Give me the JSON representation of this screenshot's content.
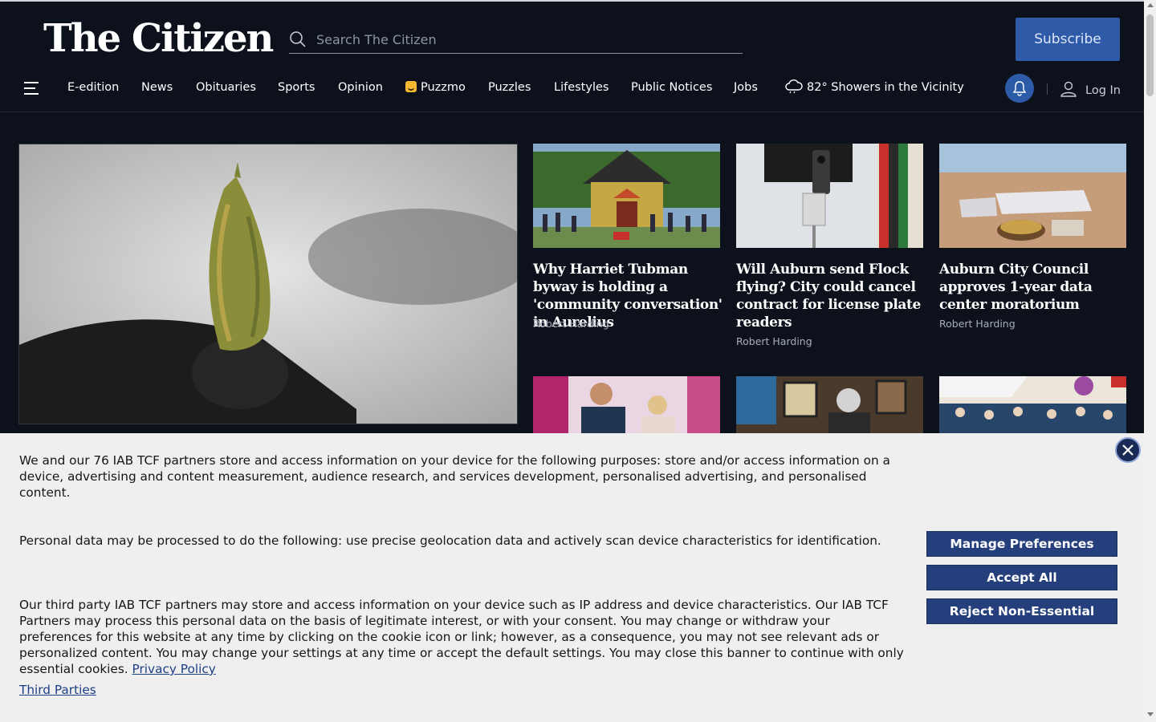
{
  "colors": {
    "page_bg": "#0c111c",
    "accent": "#2f5aa8",
    "cookie_bg": "#efefef",
    "cookie_button": "#253f7c",
    "link": "#1d3f86"
  },
  "header": {
    "logo_text": "The Citizen",
    "search_placeholder": "Search The Citizen",
    "search_icon": "search-icon",
    "subscribe_label": "Subscribe"
  },
  "nav": {
    "menu_icon": "hamburger-icon",
    "items": [
      "E-edition",
      "News",
      "Obituaries",
      "Sports",
      "Opinion",
      "Puzzmo",
      "Puzzles",
      "Lifestyles",
      "Public Notices",
      "Jobs"
    ],
    "puzzmo_icon": "puzzmo-icon",
    "weather_icon": "cloud-rain-icon",
    "weather_text": "82° Showers in the Vicinity",
    "notifications_icon": "bell-icon",
    "login_icon": "user-icon",
    "login_label": "Log In"
  },
  "articles": [
    {
      "title": "Why Harriet Tubman byway is holding a 'community conversation' in Aurelius",
      "author": "Robert Harding"
    },
    {
      "title": "Will Auburn send Flock flying? City could cancel contract for license plate readers",
      "author": "Robert Harding"
    },
    {
      "title": "Auburn City Council approves 1-year data center moratorium",
      "author": "Robert Harding"
    }
  ],
  "cookie": {
    "paragraph_1": "We and our 76 IAB TCF partners store and access information on your device for the following purposes: store and/or access information on a device, advertising and content measurement, audience research, and services development, personalised advertising, and personalised content.",
    "paragraph_2": "Personal data may be processed to do the following: use precise geolocation data and actively scan device characteristics for identification.",
    "paragraph_3": "Our third party IAB TCF partners may store and access information on your device such as IP address and device characteristics. Our IAB TCF Partners may process this personal data on the basis of legitimate interest, or with your consent. You may change or withdraw your preferences for this website at any time by clicking on the cookie icon or link; however, as a consequence, you may not see relevant ads or personalized content. You may change your settings at any time or accept the default settings. You may close this banner to continue with only essential cookies.",
    "privacy_link": "Privacy Policy",
    "third_parties_link": "Third Parties",
    "manage_label": "Manage Preferences",
    "accept_label": "Accept All",
    "reject_label": "Reject Non-Essential",
    "close_icon": "close-icon"
  }
}
